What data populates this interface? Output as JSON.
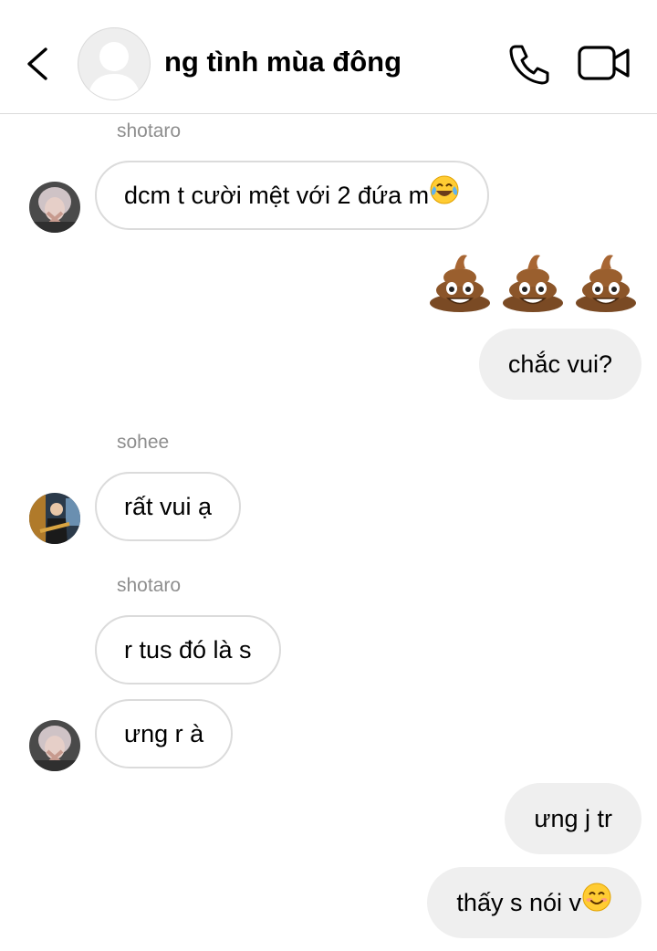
{
  "header": {
    "title": "ng tình mùa đông",
    "back_icon": "chevron-left-icon",
    "call_icon": "phone-icon",
    "video_icon": "video-camera-icon"
  },
  "messages": [
    {
      "type": "sender",
      "text": "shotaro"
    },
    {
      "type": "incoming",
      "text": "dcm t cười mệt với 2 đứa m",
      "emoji": "face-with-tears-of-joy"
    },
    {
      "type": "outgoing-emoji",
      "emoji": "pile-of-poo",
      "count": 3
    },
    {
      "type": "outgoing",
      "text": "chắc vui?"
    },
    {
      "type": "sender",
      "text": "sohee"
    },
    {
      "type": "incoming",
      "text": "rất vui ạ"
    },
    {
      "type": "sender",
      "text": "shotaro"
    },
    {
      "type": "incoming",
      "text": "r tus đó là s"
    },
    {
      "type": "incoming",
      "text": "ưng r à"
    },
    {
      "type": "outgoing",
      "text": "ưng j tr"
    },
    {
      "type": "outgoing",
      "text": "thấy s nói v",
      "emoji": "smiling-face-with-smiling-eyes"
    }
  ],
  "colors": {
    "incoming_border": "#dbdbdb",
    "outgoing_bg": "#efefef",
    "sender_text": "#8e8e8e",
    "divider": "#dbdbdb"
  }
}
